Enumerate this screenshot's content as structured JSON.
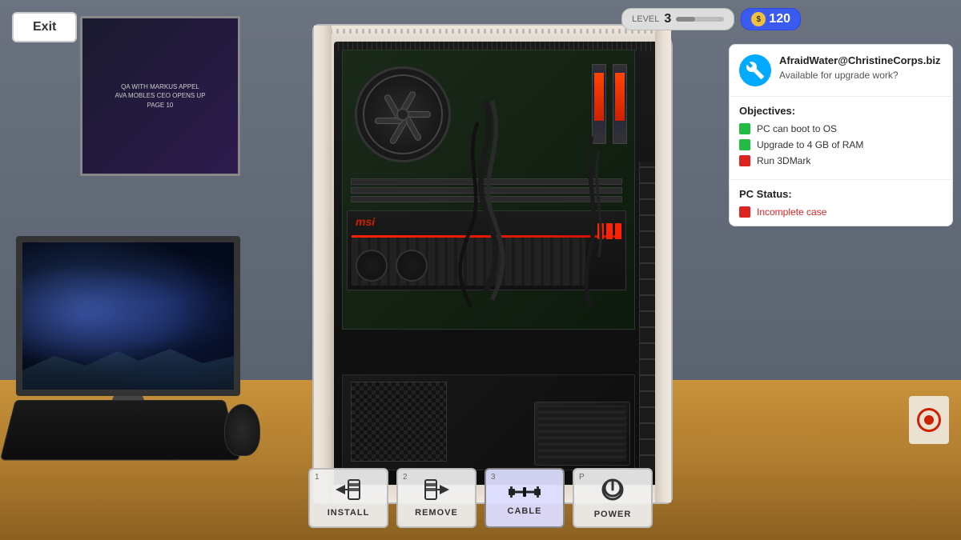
{
  "ui": {
    "exit_button": "Exit",
    "hud": {
      "level_label": "LEVEL",
      "level_num": "3",
      "money_symbol": "$",
      "money_amount": "120"
    },
    "info_panel": {
      "contact_name": "AfraidWater@ChristineCorps.biz",
      "contact_subtitle": "Available for upgrade work?",
      "objectives_title": "Objectives:",
      "objectives": [
        {
          "text": "PC can boot to OS",
          "status": "green"
        },
        {
          "text": "Upgrade to 4 GB of RAM",
          "status": "green"
        },
        {
          "text": "Run 3DMark",
          "status": "red"
        }
      ],
      "pc_status_title": "PC Status:",
      "pc_status_text": "Incomplete case",
      "pc_status_color": "red"
    },
    "action_bar": [
      {
        "key": "1",
        "label": "INSTALL",
        "icon": "install"
      },
      {
        "key": "2",
        "label": "REMOVE",
        "icon": "remove"
      },
      {
        "key": "3",
        "label": "CABLE",
        "icon": "cable",
        "active": true
      },
      {
        "key": "P",
        "label": "POWER",
        "icon": "power"
      }
    ]
  },
  "colors": {
    "accent_blue": "#00aaff",
    "money_blue": "#3a5af0",
    "status_green": "#22bb44",
    "status_red": "#dd2222",
    "panel_bg": "#ffffff",
    "active_btn": "rgba(200,200,230,0.95)"
  }
}
